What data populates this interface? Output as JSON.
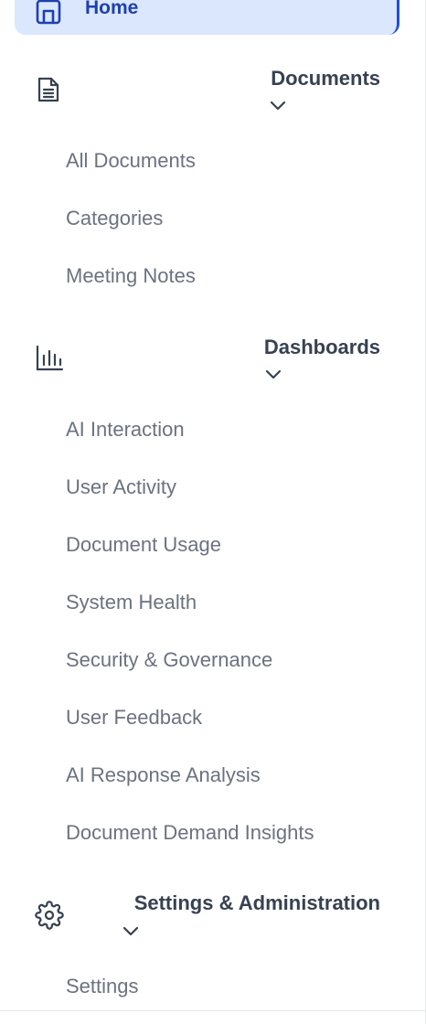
{
  "nav": {
    "home": {
      "label": "Home",
      "icon": "home-icon",
      "active": true
    },
    "documents": {
      "title": "Documents",
      "icon": "document-icon",
      "expanded": true,
      "items": [
        {
          "label": "All Documents"
        },
        {
          "label": "Categories"
        },
        {
          "label": "Meeting Notes"
        }
      ]
    },
    "dashboards": {
      "title": "Dashboards",
      "icon": "bar-chart-icon",
      "expanded": true,
      "items": [
        {
          "label": "AI Interaction"
        },
        {
          "label": "User Activity"
        },
        {
          "label": "Document Usage"
        },
        {
          "label": "System Health"
        },
        {
          "label": "Security & Governance"
        },
        {
          "label": "User Feedback"
        },
        {
          "label": "AI Response Analysis"
        },
        {
          "label": "Document Demand Insights"
        }
      ]
    },
    "settings": {
      "title": "Settings & Administration",
      "icon": "gear-icon",
      "expanded": true,
      "items": [
        {
          "label": "Settings"
        }
      ]
    }
  },
  "colors": {
    "active_bg": "#dbe7fd",
    "active_text": "#1e40af",
    "active_border": "#1d4ed8",
    "section_text": "#374151",
    "item_text": "#6b7280"
  }
}
